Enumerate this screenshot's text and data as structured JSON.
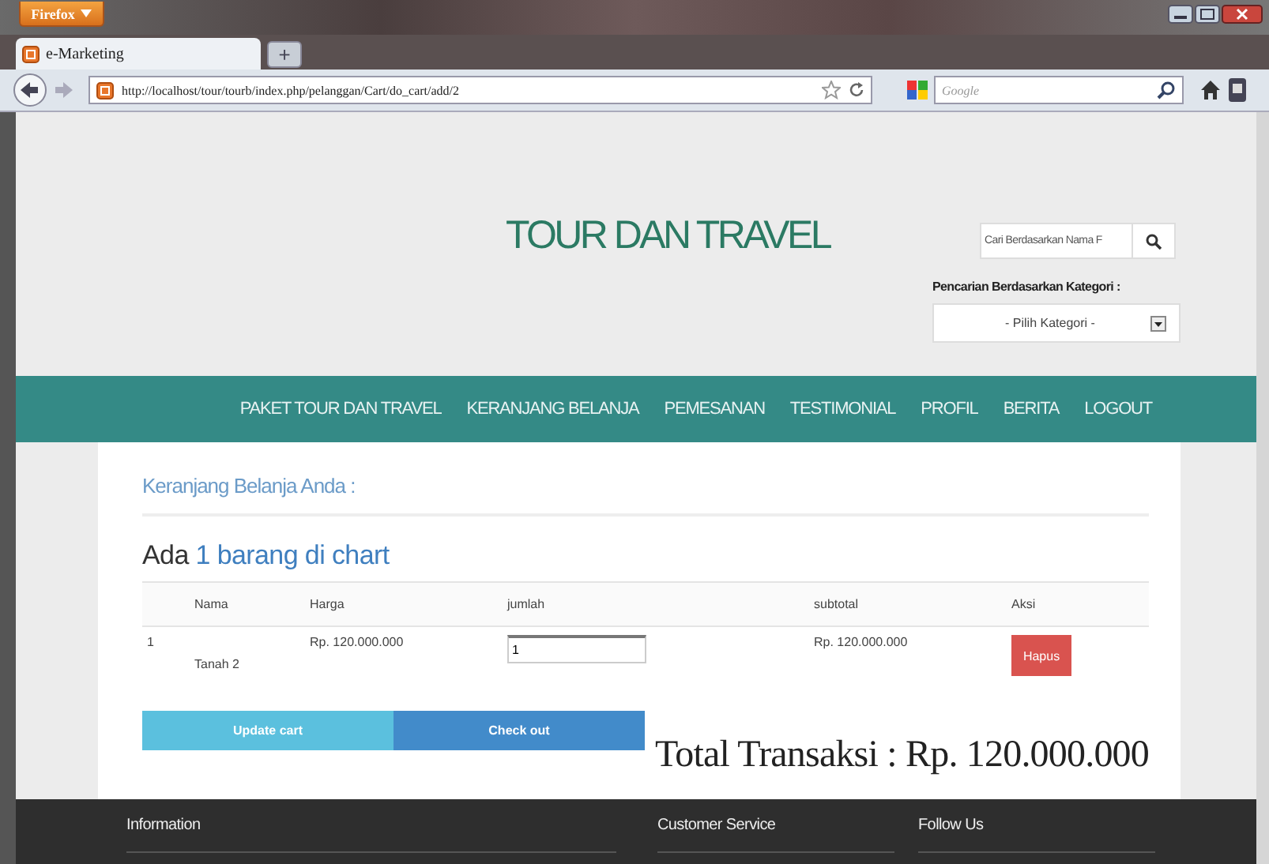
{
  "browser": {
    "menu_button": "Firefox",
    "tab": {
      "title": "e-Marketing",
      "selected": true
    },
    "new_tab": "+",
    "url": "http://localhost/tour/tourb/index.php/pelanggan/Cart/do_cart/add/2",
    "search_placeholder": "Google"
  },
  "header": {
    "title": "TOUR DAN TRAVEL",
    "search_placeholder": "Cari Berdasarkan Nama F",
    "category_label": "Pencarian Berdasarkan Kategori :",
    "category_select": "- Pilih Kategori -"
  },
  "nav": [
    {
      "label": "PAKET TOUR DAN TRAVEL"
    },
    {
      "label": "KERANJANG BELANJA"
    },
    {
      "label": "PEMESANAN"
    },
    {
      "label": "TESTIMONIAL"
    },
    {
      "label": "PROFIL"
    },
    {
      "label": "BERITA"
    },
    {
      "label": "LOGOUT"
    }
  ],
  "cart": {
    "heading": "Keranjang Belanja Anda :",
    "summary_prefix": "Ada",
    "summary_count": "1 barang di chart",
    "columns": [
      "Nama",
      "Harga",
      "jumlah",
      "subtotal",
      "Aksi"
    ],
    "rows": [
      {
        "number": "1",
        "name": "Tanah 2",
        "price": "Rp. 120.000.000",
        "quantity": "1",
        "subtotal": "Rp. 120.000.000",
        "action": "Hapus"
      }
    ],
    "buttons": [
      {
        "label": "Update cart",
        "kind": "update"
      },
      {
        "label": "Check out",
        "kind": "checkout"
      }
    ],
    "total": "Total Transaksi : Rp. 120.000.000"
  },
  "footer": {
    "headings": [
      "Information",
      "Customer Service",
      "Follow Us"
    ]
  }
}
